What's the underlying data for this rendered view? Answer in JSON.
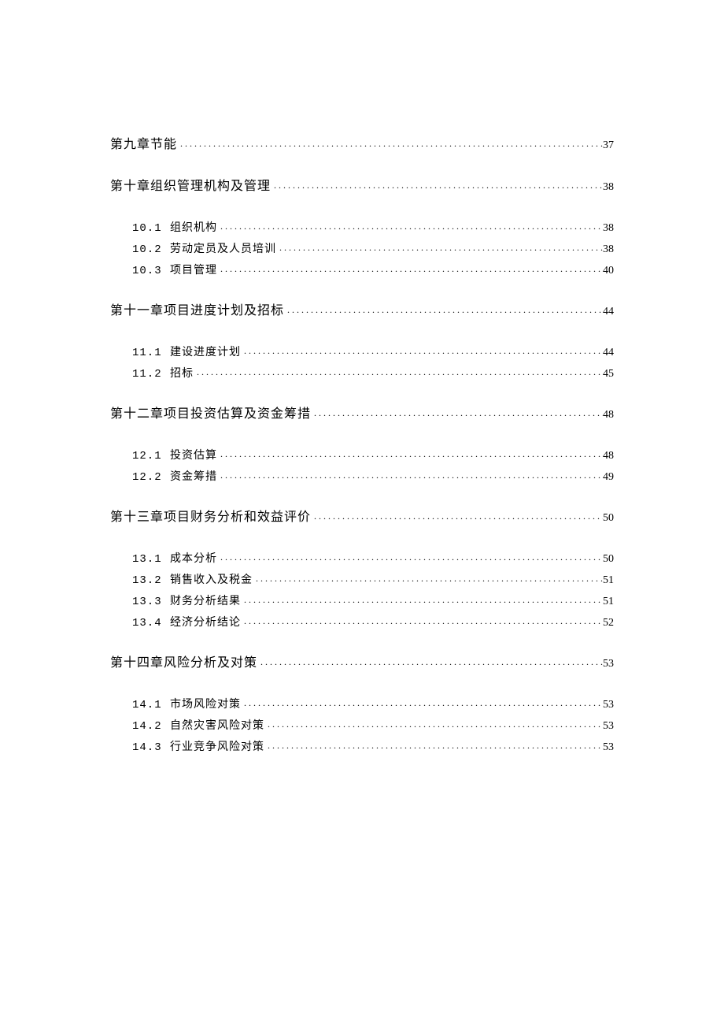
{
  "toc": [
    {
      "title": "第九章节能",
      "page": "37",
      "sections": []
    },
    {
      "title": "第十章组织管理机构及管理",
      "page": "38",
      "sections": [
        {
          "number": "10.1",
          "title": "组织机构",
          "page": "38"
        },
        {
          "number": "10.2",
          "title": "劳动定员及人员培训",
          "page": "38"
        },
        {
          "number": "10.3",
          "title": "项目管理",
          "page": "40"
        }
      ]
    },
    {
      "title": "第十一章项目进度计划及招标",
      "page": "44",
      "sections": [
        {
          "number": "11.1",
          "title": "建设进度计划",
          "page": "44"
        },
        {
          "number": "11.2",
          "title": "招标",
          "page": "45"
        }
      ]
    },
    {
      "title": "第十二章项目投资估算及资金筹措",
      "page": "48",
      "sections": [
        {
          "number": "12.1",
          "title": "投资估算",
          "page": "48"
        },
        {
          "number": "12.2",
          "title": "资金筹措",
          "page": "49"
        }
      ]
    },
    {
      "title": "第十三章项目财务分析和效益评价",
      "page": "50",
      "sections": [
        {
          "number": "13.1",
          "title": "成本分析",
          "page": "50"
        },
        {
          "number": "13.2",
          "title": "销售收入及税金",
          "page": "51"
        },
        {
          "number": "13.3",
          "title": "财务分析结果",
          "page": "51"
        },
        {
          "number": "13.4",
          "title": "经济分析结论",
          "page": "52"
        }
      ]
    },
    {
      "title": "第十四章风险分析及对策",
      "page": "53",
      "sections": [
        {
          "number": "14.1",
          "title": "市场风险对策",
          "page": "53"
        },
        {
          "number": "14.2",
          "title": "自然灾害风险对策",
          "page": "53"
        },
        {
          "number": "14.3",
          "title": "行业竞争风险对策",
          "page": "53"
        }
      ]
    }
  ]
}
